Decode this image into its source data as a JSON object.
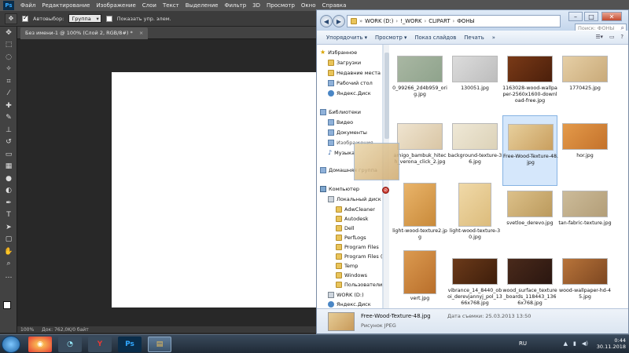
{
  "photoshop": {
    "logo": "Ps",
    "menu": [
      "Файл",
      "Редактирование",
      "Изображение",
      "Слои",
      "Текст",
      "Выделение",
      "Фильтр",
      "3D",
      "Просмотр",
      "Окно",
      "Справка"
    ],
    "options": {
      "autoselect_label": "Автовыбор:",
      "autoselect_value": "Группа",
      "show_controls_label": "Показать упр. элем."
    },
    "tab_title": "Без имени-1 @ 100% (Слой 2, RGB/8#) *",
    "tab_close": "×",
    "status_zoom": "100%",
    "status_doc": "Док: 762,0K/0 байт"
  },
  "explorer": {
    "breadcrumb": [
      "WORK (D:)",
      "!_WORK",
      "CLIPART",
      "ФОНЫ"
    ],
    "search_placeholder": "Поиск: ФОНЫ",
    "toolbar": [
      "Упорядочить ▾",
      "Просмотр ▾",
      "Показ слайдов",
      "Печать",
      "»"
    ],
    "nav": {
      "favorites": "Избранное",
      "downloads": "Загрузки",
      "recent": "Недавние места",
      "desktop": "Рабочий стол",
      "yandex1": "Яндекс.Диск",
      "libraries": "Библиотеки",
      "video": "Видео",
      "documents": "Документы",
      "images": "Изображения",
      "music": "Музыка",
      "home": "Домашняя группа",
      "computer": "Компьютер",
      "local": "Локальный диск",
      "folders": [
        "AdwCleaner",
        "Autodesk",
        "Dell",
        "PerfLogs",
        "Program Files",
        "Program Files (",
        "Temp",
        "Windows",
        "Пользователи"
      ],
      "work": "WORK (D:)",
      "yandex2": "Яндекс.Диск"
    },
    "files": [
      {
        "name": "0_99266_2d4b959_orig.jpg",
        "color1": "#a9b7a3",
        "color2": "#8fa38c"
      },
      {
        "name": "130051.jpg",
        "color1": "#dcdcdc",
        "color2": "#bdbdbd"
      },
      {
        "name": "1163028-wood-wallpaper-2560x1600-download-free.jpg",
        "color1": "#7a3a17",
        "color2": "#4b1f0b"
      },
      {
        "name": "1770425.jpg",
        "color1": "#e6cfa6",
        "color2": "#c9aa79"
      },
      {
        "name": "amigo_bambuk_hitech_verona_click_2.jpg",
        "color1": "#efe4d0",
        "color2": "#d9c6a5"
      },
      {
        "name": "background-texture-36.jpg",
        "color1": "#efe8d6",
        "color2": "#dcd2b8"
      },
      {
        "name": "Free-Wood-Texture-48.jpg",
        "color1": "#e7cf9c",
        "color2": "#c99f5f"
      },
      {
        "name": "hor.jpg",
        "color1": "#e49a4a",
        "color2": "#c4722b"
      },
      {
        "name": "light-wood-texture2.jpg",
        "color1": "#e9b46a",
        "color2": "#c98a3a"
      },
      {
        "name": "light-wood-texture-30.jpg",
        "color1": "#f0d9a8",
        "color2": "#dcbc7c"
      },
      {
        "name": "svetloe_derevo.jpg",
        "color1": "#dcc089",
        "color2": "#bb9a5d"
      },
      {
        "name": "tan-fabric-texture.jpg",
        "color1": "#ccbb99",
        "color2": "#b39e78"
      },
      {
        "name": "vert.jpg",
        "color1": "#db9a50",
        "color2": "#b96f2b"
      },
      {
        "name": "vibrance_14_8440_oboi_derevjannyj_pol_1366x768.jpg",
        "color1": "#6b3a1a",
        "color2": "#3e1e0b"
      },
      {
        "name": "wood_surface_texture_boards_118443_1366x768.jpg",
        "color1": "#4a2a1b",
        "color2": "#2a1610"
      },
      {
        "name": "wood-wallpaper-hd-45.jpg",
        "color1": "#b8743a",
        "color2": "#7d4721"
      }
    ],
    "selected_file": "Free-Wood-Texture-48.jpg",
    "details": {
      "name": "Free-Wood-Texture-48.jpg",
      "type": "Рисунок JPEG",
      "date_label": "Дата съемки: 25.03.2013 13:50"
    }
  },
  "taskbar": {
    "lang": "RU",
    "time": "0:44",
    "date": "30.11.2018",
    "apps": [
      "chrome",
      "media",
      "yandex",
      "ps",
      "explorer"
    ]
  }
}
